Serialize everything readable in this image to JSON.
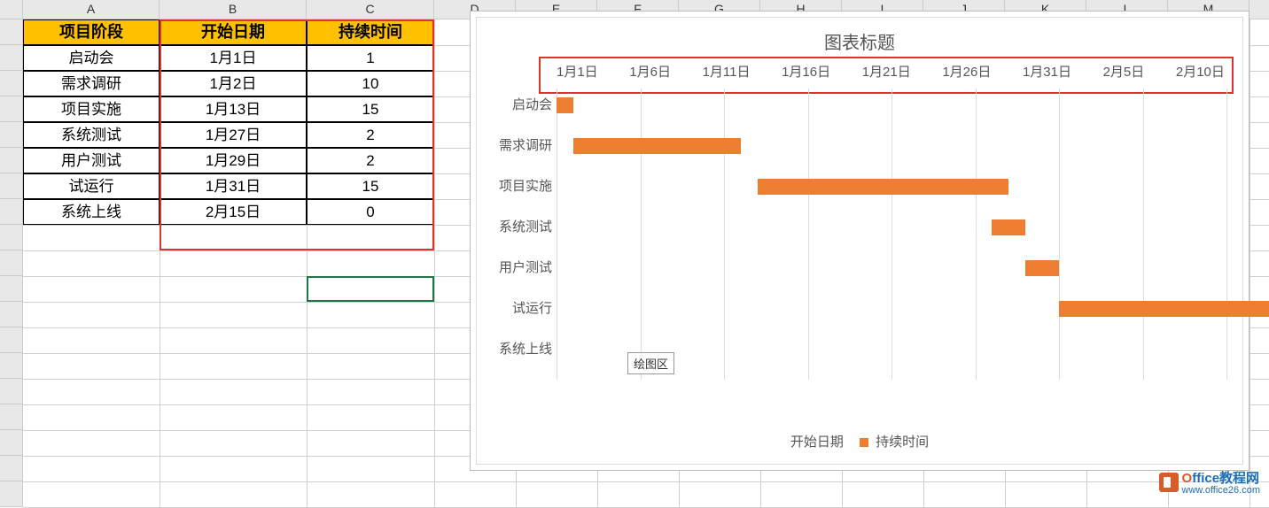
{
  "columns": [
    "A",
    "B",
    "C",
    "D",
    "E",
    "F",
    "G",
    "H",
    "I",
    "J",
    "K",
    "L",
    "M"
  ],
  "table": {
    "headers": [
      "项目阶段",
      "开始日期",
      "持续时间"
    ],
    "rows": [
      {
        "phase": "启动会",
        "start": "1月1日",
        "duration": "1"
      },
      {
        "phase": "需求调研",
        "start": "1月2日",
        "duration": "10"
      },
      {
        "phase": "项目实施",
        "start": "1月13日",
        "duration": "15"
      },
      {
        "phase": "系统测试",
        "start": "1月27日",
        "duration": "2"
      },
      {
        "phase": "用户测试",
        "start": "1月29日",
        "duration": "2"
      },
      {
        "phase": "试运行",
        "start": "1月31日",
        "duration": "15"
      },
      {
        "phase": "系统上线",
        "start": "2月15日",
        "duration": "0"
      }
    ]
  },
  "chart_title": "图表标题",
  "plot_area_label": "绘图区",
  "legend": {
    "series1": "开始日期",
    "series2": "持续时间"
  },
  "watermark": {
    "title_o": "O",
    "title_rest": "ffice教程网",
    "url": "www.office26.com"
  },
  "chart_data": {
    "type": "bar",
    "orientation": "horizontal-stacked-gantt",
    "title": "图表标题",
    "x_ticks": [
      "1月1日",
      "1月6日",
      "1月11日",
      "1月16日",
      "1月21日",
      "1月26日",
      "1月31日",
      "2月5日",
      "2月10日"
    ],
    "x_start_day": 1,
    "x_end_day": 41,
    "categories": [
      "启动会",
      "需求调研",
      "项目实施",
      "系统测试",
      "用户测试",
      "试运行",
      "系统上线"
    ],
    "series": [
      {
        "name": "开始日期",
        "values": [
          1,
          2,
          13,
          27,
          29,
          31,
          46
        ],
        "role": "offset-invisible"
      },
      {
        "name": "持续时间",
        "values": [
          1,
          10,
          15,
          2,
          2,
          15,
          0
        ],
        "color": "#ed7d31"
      }
    ]
  }
}
